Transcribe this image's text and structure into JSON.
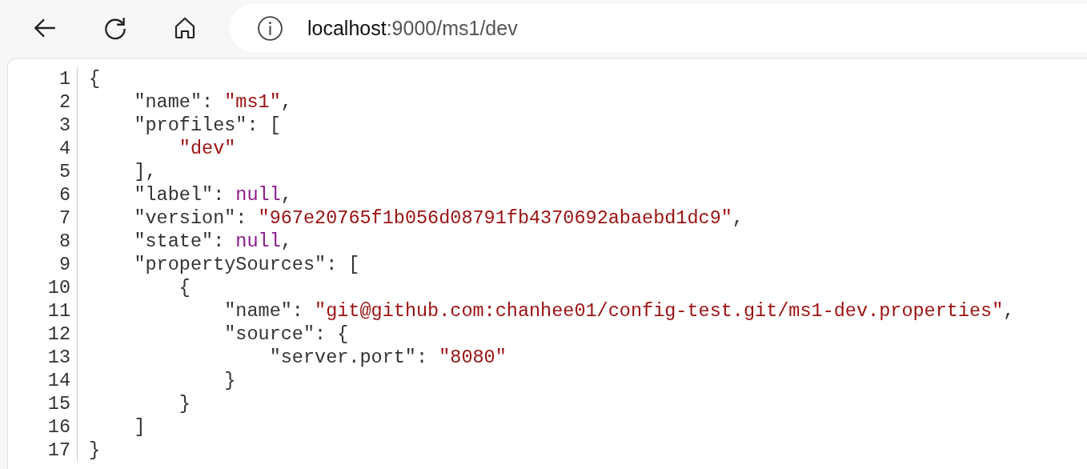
{
  "address_bar": {
    "host": "localhost",
    "path": ":9000/ms1/dev"
  },
  "lines": [
    {
      "number": "1",
      "tokens": [
        {
          "kind": "punct",
          "text": "{"
        }
      ]
    },
    {
      "number": "2",
      "tokens": [
        {
          "kind": "key",
          "text": "    \"name\""
        },
        {
          "kind": "punct",
          "text": ": "
        },
        {
          "kind": "string",
          "text": "\"ms1\""
        },
        {
          "kind": "punct",
          "text": ","
        }
      ]
    },
    {
      "number": "3",
      "tokens": [
        {
          "kind": "key",
          "text": "    \"profiles\""
        },
        {
          "kind": "punct",
          "text": ": ["
        }
      ]
    },
    {
      "number": "4",
      "tokens": [
        {
          "kind": "string",
          "text": "        \"dev\""
        }
      ]
    },
    {
      "number": "5",
      "tokens": [
        {
          "kind": "punct",
          "text": "    ],"
        }
      ]
    },
    {
      "number": "6",
      "tokens": [
        {
          "kind": "key",
          "text": "    \"label\""
        },
        {
          "kind": "punct",
          "text": ": "
        },
        {
          "kind": "null",
          "text": "null"
        },
        {
          "kind": "punct",
          "text": ","
        }
      ]
    },
    {
      "number": "7",
      "tokens": [
        {
          "kind": "key",
          "text": "    \"version\""
        },
        {
          "kind": "punct",
          "text": ": "
        },
        {
          "kind": "string",
          "text": "\"967e20765f1b056d08791fb4370692abaebd1dc9\""
        },
        {
          "kind": "punct",
          "text": ","
        }
      ]
    },
    {
      "number": "8",
      "tokens": [
        {
          "kind": "key",
          "text": "    \"state\""
        },
        {
          "kind": "punct",
          "text": ": "
        },
        {
          "kind": "null",
          "text": "null"
        },
        {
          "kind": "punct",
          "text": ","
        }
      ]
    },
    {
      "number": "9",
      "tokens": [
        {
          "kind": "key",
          "text": "    \"propertySources\""
        },
        {
          "kind": "punct",
          "text": ": ["
        }
      ]
    },
    {
      "number": "10",
      "tokens": [
        {
          "kind": "punct",
          "text": "        {"
        }
      ]
    },
    {
      "number": "11",
      "tokens": [
        {
          "kind": "key",
          "text": "            \"name\""
        },
        {
          "kind": "punct",
          "text": ": "
        },
        {
          "kind": "string",
          "text": "\"git@github.com:chanhee01/config-test.git/ms1-dev.properties\""
        },
        {
          "kind": "punct",
          "text": ","
        }
      ]
    },
    {
      "number": "12",
      "tokens": [
        {
          "kind": "key",
          "text": "            \"source\""
        },
        {
          "kind": "punct",
          "text": ": {"
        }
      ]
    },
    {
      "number": "13",
      "tokens": [
        {
          "kind": "key",
          "text": "                \"server.port\""
        },
        {
          "kind": "punct",
          "text": ": "
        },
        {
          "kind": "string",
          "text": "\"8080\""
        }
      ]
    },
    {
      "number": "14",
      "tokens": [
        {
          "kind": "punct",
          "text": "            }"
        }
      ]
    },
    {
      "number": "15",
      "tokens": [
        {
          "kind": "punct",
          "text": "        }"
        }
      ]
    },
    {
      "number": "16",
      "tokens": [
        {
          "kind": "punct",
          "text": "    ]"
        }
      ]
    },
    {
      "number": "17",
      "tokens": [
        {
          "kind": "punct",
          "text": "}"
        }
      ]
    }
  ]
}
